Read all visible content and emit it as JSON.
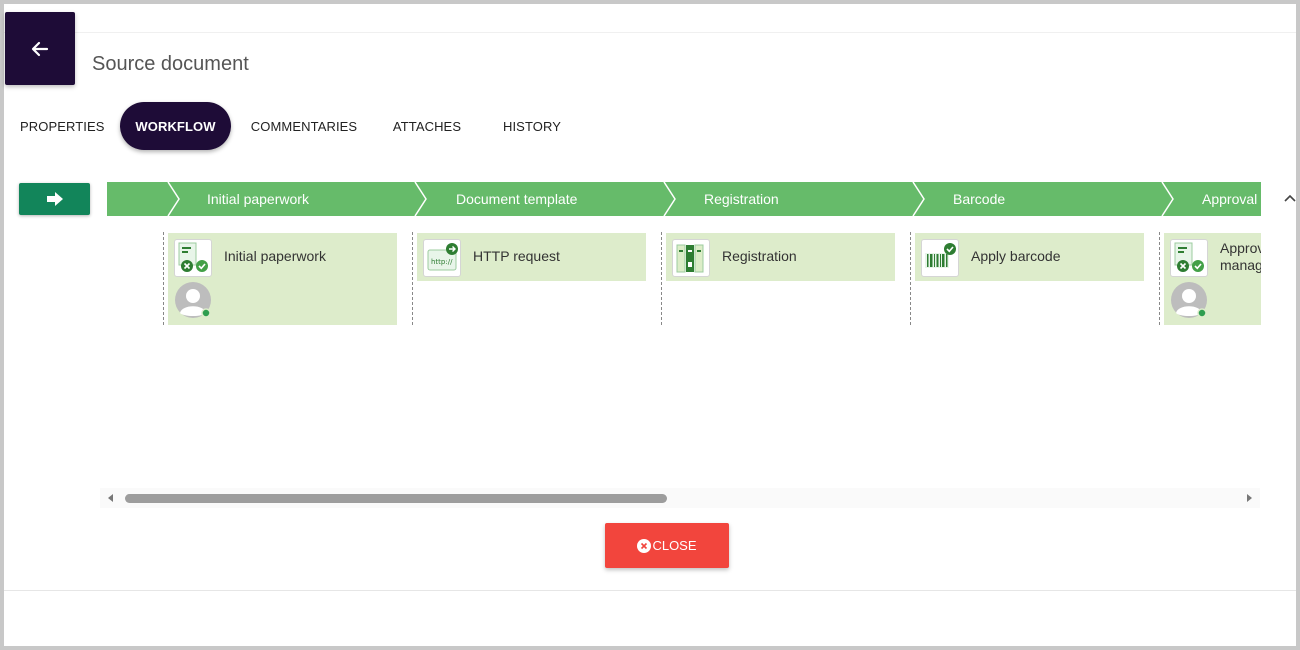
{
  "header": {
    "title": "Source document",
    "back_icon": "arrow-left-icon",
    "colors": {
      "header_dark": "#1e0c37"
    }
  },
  "tabs": [
    {
      "label": "PROPERTIES",
      "active": false
    },
    {
      "label": "WORKFLOW",
      "active": true
    },
    {
      "label": "COMMENTARIES",
      "active": false
    },
    {
      "label": "ATTACHES",
      "active": false
    },
    {
      "label": "HISTORY",
      "active": false
    }
  ],
  "workflow": {
    "start_icon": "arrow-right-icon",
    "stages": [
      {
        "label": "Initial paperwork"
      },
      {
        "label": "Document template"
      },
      {
        "label": "Registration"
      },
      {
        "label": "Barcode"
      },
      {
        "label": "Approval"
      }
    ],
    "steps": [
      {
        "label": "Initial paperwork",
        "icon": "document-approve-icon",
        "has_avatar": true
      },
      {
        "label": "HTTP request",
        "icon": "http-request-icon",
        "has_avatar": false
      },
      {
        "label": "Registration",
        "icon": "registry-binders-icon",
        "has_avatar": false
      },
      {
        "label": "Apply barcode",
        "icon": "barcode-icon",
        "has_avatar": false
      },
      {
        "label": "Approval by manager",
        "label_line1": "Approval",
        "label_line2": "manager",
        "icon": "document-approve-icon",
        "has_avatar": true
      }
    ],
    "colors": {
      "stage_green": "#66bb6a",
      "step_bg": "#ddeccb",
      "start_btn": "#12855a"
    }
  },
  "footer": {
    "close_label": "CLOSE",
    "close_icon": "close-circle-icon",
    "colors": {
      "close_red": "#f2453d"
    }
  }
}
